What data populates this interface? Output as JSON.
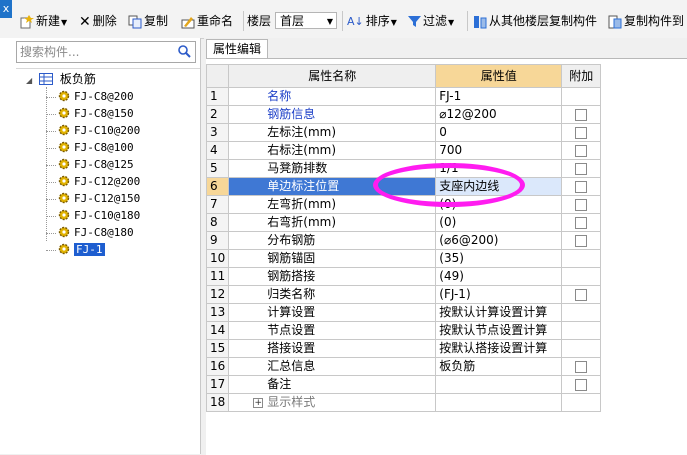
{
  "window": {
    "close_glyph": "x"
  },
  "toolbar": {
    "new_label": "新建",
    "delete_label": "删除",
    "copy_label": "复制",
    "rename_label": "重命名",
    "floor_label": "楼层",
    "floor_value": "首层",
    "sort_label": "排序",
    "filter_label": "过滤",
    "copy_from_floor_label": "从其他楼层复制构件",
    "copy_to_label": "复制构件到"
  },
  "search": {
    "placeholder": "搜索构件..."
  },
  "tree": {
    "root_label": "板负筋",
    "items": [
      "FJ-C8@200",
      "FJ-C8@150",
      "FJ-C10@200",
      "FJ-C8@100",
      "FJ-C8@125",
      "FJ-C12@200",
      "FJ-C12@150",
      "FJ-C10@180",
      "FJ-C8@180",
      "FJ-1"
    ],
    "selected_index": 9
  },
  "panel": {
    "tab_label": "属性编辑"
  },
  "grid": {
    "headers": {
      "name": "属性名称",
      "value": "属性值",
      "extra": "附加"
    },
    "rows": [
      {
        "num": "1",
        "name": "名称",
        "value": "FJ-1",
        "check": false
      },
      {
        "num": "2",
        "name": "钢筋信息",
        "value": "⌀12@200",
        "check": true
      },
      {
        "num": "3",
        "name": "左标注(mm)",
        "value": "0",
        "check": true
      },
      {
        "num": "4",
        "name": "右标注(mm)",
        "value": "700",
        "check": true
      },
      {
        "num": "5",
        "name": "马凳筋排数",
        "value": "1/1",
        "check": true
      },
      {
        "num": "6",
        "name": "单边标注位置",
        "value": "支座内边线",
        "check": true
      },
      {
        "num": "7",
        "name": "左弯折(mm)",
        "value": "(0)",
        "check": true
      },
      {
        "num": "8",
        "name": "右弯折(mm)",
        "value": "(0)",
        "check": true
      },
      {
        "num": "9",
        "name": "分布钢筋",
        "value": "(⌀6@200)",
        "check": true
      },
      {
        "num": "10",
        "name": "钢筋锚固",
        "value": "(35)",
        "check": false
      },
      {
        "num": "11",
        "name": "钢筋搭接",
        "value": "(49)",
        "check": false
      },
      {
        "num": "12",
        "name": "归类名称",
        "value": "(FJ-1)",
        "check": true
      },
      {
        "num": "13",
        "name": "计算设置",
        "value": "按默认计算设置计算",
        "check": false
      },
      {
        "num": "14",
        "name": "节点设置",
        "value": "按默认节点设置计算",
        "check": false
      },
      {
        "num": "15",
        "name": "搭接设置",
        "value": "按默认搭接设置计算",
        "check": false
      },
      {
        "num": "16",
        "name": "汇总信息",
        "value": "板负筋",
        "check": true
      },
      {
        "num": "17",
        "name": "备注",
        "value": "",
        "check": true
      },
      {
        "num": "18",
        "name": "显示样式",
        "value": "",
        "check": false
      }
    ],
    "selected_row": 6
  },
  "colors": {
    "highlight_ellipse": "#ff1cf0",
    "selection": "#3f78d4",
    "header_value": "#f7d798"
  }
}
